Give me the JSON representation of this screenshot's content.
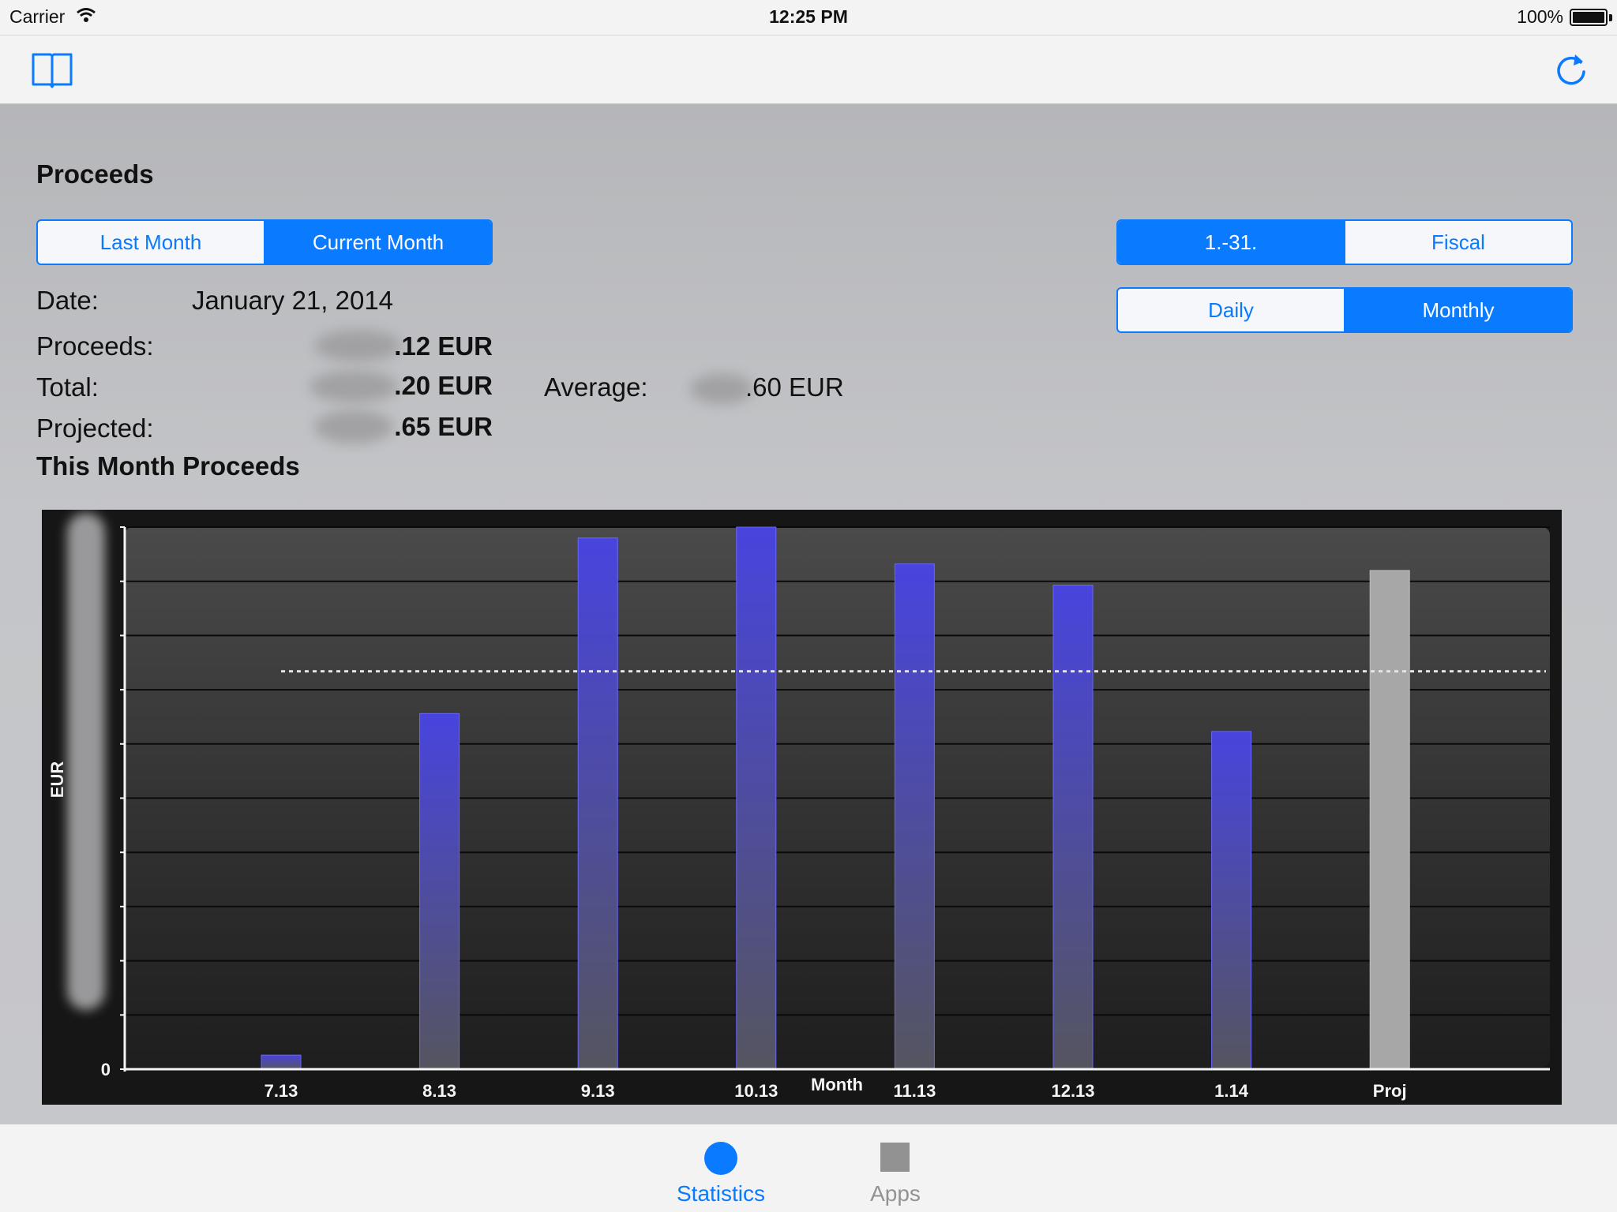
{
  "status_bar": {
    "carrier": "Carrier",
    "time": "12:25 PM",
    "battery": "100%"
  },
  "nav": {
    "left_icon": "book-icon",
    "right_icon": "refresh-icon"
  },
  "proceeds": {
    "title": "Proceeds",
    "period_segment": {
      "items": [
        "Last Month",
        "Current Month"
      ],
      "selected": 1
    },
    "range_segment": {
      "items": [
        "1.-31.",
        "Fiscal"
      ],
      "selected": 0
    },
    "granularity_segment": {
      "items": [
        "Daily",
        "Monthly"
      ],
      "selected": 1
    },
    "date_label": "Date:",
    "date_value": "January 21, 2014",
    "proceeds_label": "Proceeds:",
    "proceeds_value": ".12 EUR",
    "total_label": "Total:",
    "total_value": ".20 EUR",
    "average_label": "Average:",
    "average_value": ".60 EUR",
    "projected_label": "Projected:",
    "projected_value": ".65 EUR"
  },
  "chart_title": "This Month Proceeds",
  "chart_data": {
    "type": "bar",
    "categories": [
      "7.13",
      "8.13",
      "9.13",
      "10.13",
      "11.13",
      "12.13",
      "1.14",
      "Proj"
    ],
    "values": [
      2.6,
      65.6,
      98,
      100,
      93.2,
      89.3,
      62.3,
      92
    ],
    "bar_colors": [
      "#4844d8",
      "#4844d8",
      "#4844d8",
      "#4844d8",
      "#4844d8",
      "#4844d8",
      "#4844d8",
      "#a7a7a7"
    ],
    "xlabel": "Month",
    "ylabel": "EUR",
    "ylim": [
      0,
      100
    ],
    "average_line": 73.4,
    "y_tick_labels_visible": [
      "0"
    ],
    "grid": true,
    "gridline_count": 10
  },
  "tabs": [
    {
      "label": "Statistics",
      "icon": "circle-icon",
      "active": true,
      "color": "#0a7aff"
    },
    {
      "label": "Apps",
      "icon": "square-icon",
      "active": false,
      "color": "#929292"
    }
  ]
}
